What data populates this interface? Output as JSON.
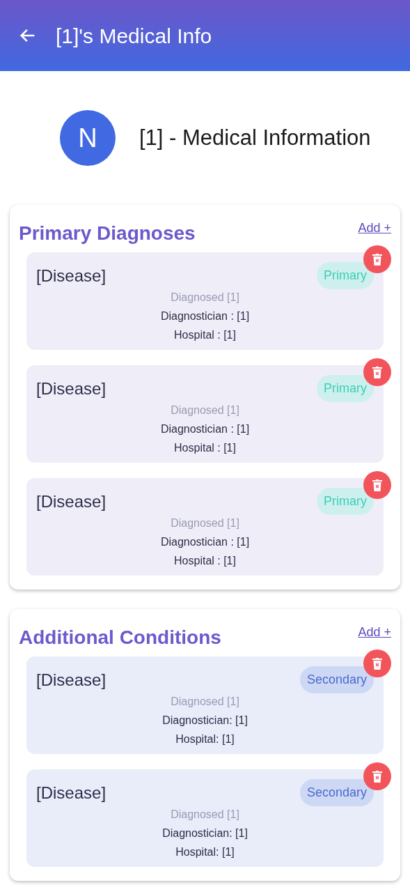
{
  "app_bar": {
    "title": "[1]'s Medical Info"
  },
  "profile": {
    "initial": "N",
    "heading": "[1] - Medical Information"
  },
  "sections": [
    {
      "title": "Primary Diagnoses",
      "add_link": "Add +",
      "items": [
        {
          "kind": "primary",
          "name": "[Disease]",
          "badge": "Primary",
          "diagnosed": "Diagnosed [1]",
          "diagnostician": "Diagnostician : [1]",
          "hospital": "Hospital : [1]"
        },
        {
          "kind": "primary",
          "name": "[Disease]",
          "badge": "Primary",
          "diagnosed": "Diagnosed [1]",
          "diagnostician": "Diagnostician : [1]",
          "hospital": "Hospital : [1]"
        },
        {
          "kind": "primary",
          "name": "[Disease]",
          "badge": "Primary",
          "diagnosed": "Diagnosed [1]",
          "diagnostician": "Diagnostician : [1]",
          "hospital": "Hospital : [1]"
        }
      ]
    },
    {
      "title": "Additional Conditions",
      "add_link": "Add +",
      "items": [
        {
          "kind": "secondary",
          "name": "[Disease]",
          "badge": "Secondary",
          "diagnosed": "Diagnosed [1]",
          "diagnostician": "Diagnostician: [1]",
          "hospital": "Hospital: [1]"
        },
        {
          "kind": "secondary",
          "name": "[Disease]",
          "badge": "Secondary",
          "diagnosed": "Diagnosed [1]",
          "diagnostician": "Diagnostician: [1]",
          "hospital": "Hospital: [1]"
        }
      ]
    }
  ]
}
